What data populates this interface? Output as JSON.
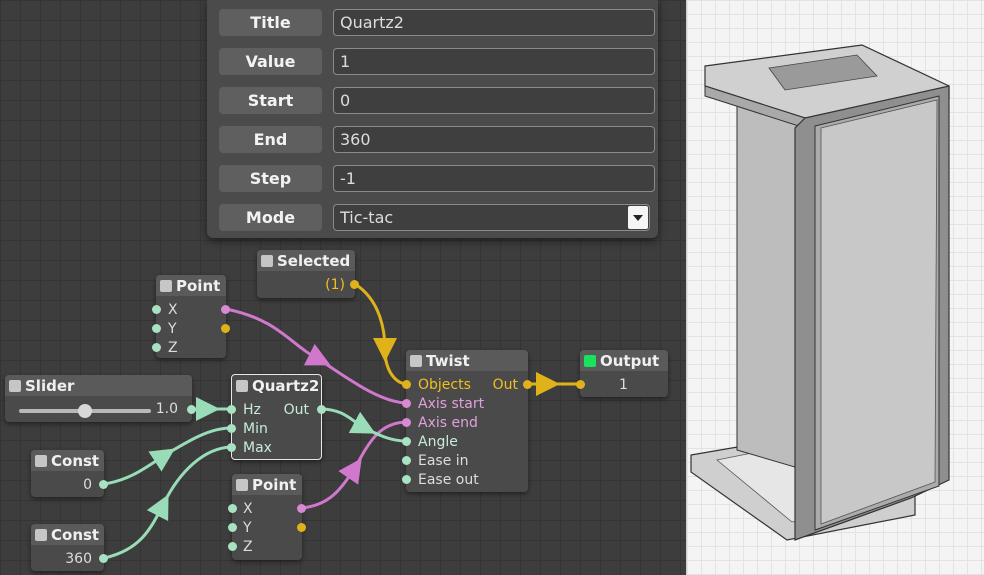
{
  "properties": {
    "rows": [
      {
        "label": "Title",
        "value": "Quartz2"
      },
      {
        "label": "Value",
        "value": "1"
      },
      {
        "label": "Start",
        "value": "0"
      },
      {
        "label": "End",
        "value": "360"
      },
      {
        "label": "Step",
        "value": "-1"
      }
    ],
    "mode": {
      "label": "Mode",
      "value": "Tic-tac"
    }
  },
  "nodes": {
    "selected": {
      "title": "Selected",
      "value": "(1)"
    },
    "point1": {
      "title": "Point",
      "ports": [
        "X",
        "Y",
        "Z"
      ]
    },
    "slider": {
      "title": "Slider",
      "value": "1.0",
      "level": 0.5
    },
    "quartz": {
      "title": "Quartz2",
      "inputs": [
        "Hz",
        "Min",
        "Max"
      ],
      "output": "Out"
    },
    "const1": {
      "title": "Const",
      "value": "0"
    },
    "const2": {
      "title": "Const",
      "value": "360"
    },
    "point2": {
      "title": "Point",
      "ports": [
        "X",
        "Y",
        "Z"
      ]
    },
    "twist": {
      "title": "Twist",
      "inputs": [
        "Objects",
        "Axis start",
        "Axis end",
        "Angle",
        "Ease in",
        "Ease out"
      ],
      "output": "Out"
    },
    "output": {
      "title": "Output",
      "value": "1"
    }
  },
  "colors": {
    "wire_geometry": "#e0b21a",
    "wire_vector": "#d078cc",
    "wire_number": "#98dcb8",
    "active_output": "#19e35a"
  }
}
